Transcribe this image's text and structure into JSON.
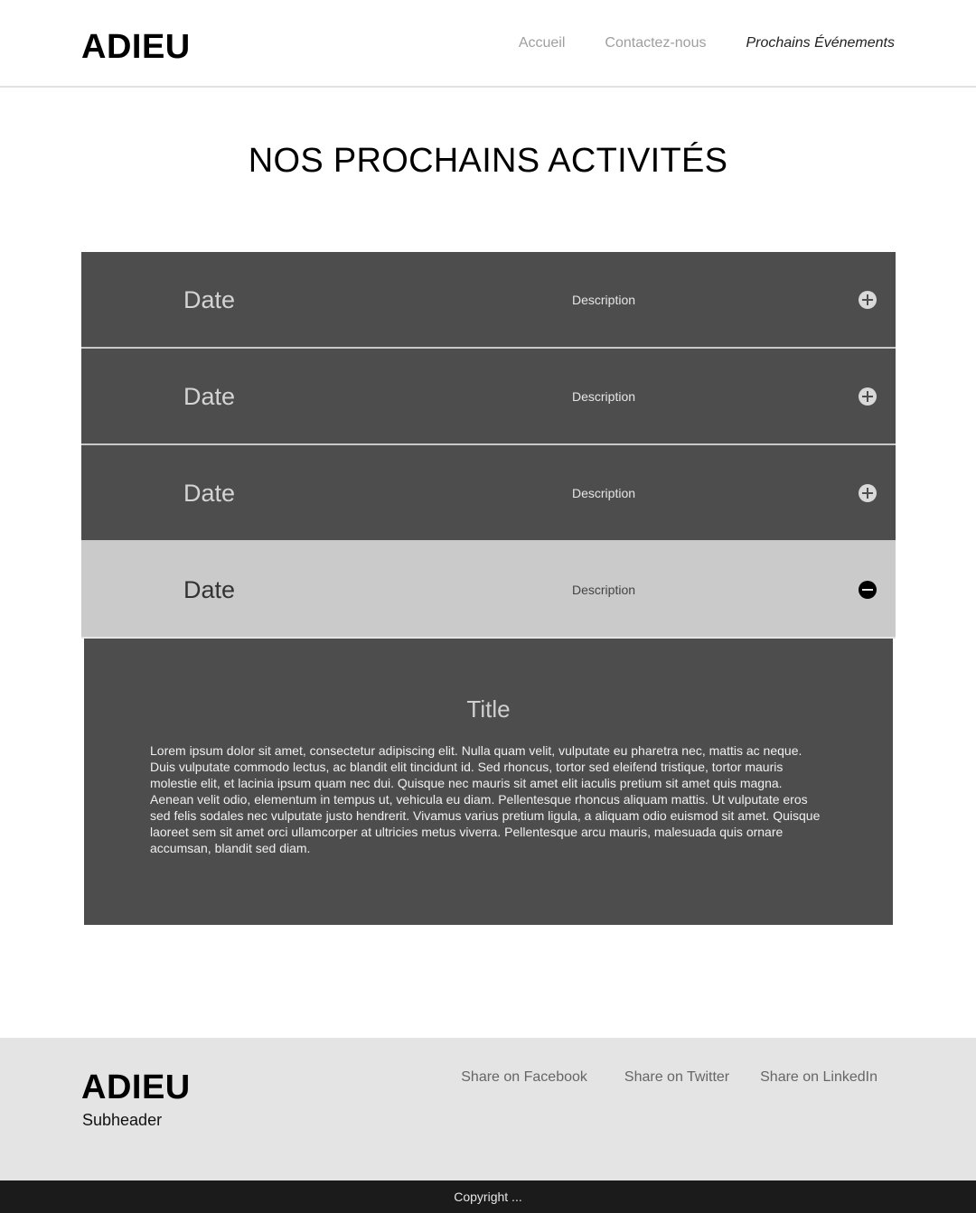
{
  "header": {
    "logo": "ADIEU",
    "nav": [
      {
        "label": "Accueil",
        "active": false
      },
      {
        "label": "Contactez-nous",
        "active": false
      },
      {
        "label": "Prochains Événements",
        "active": true
      }
    ]
  },
  "page_title": "NOS PROCHAINS ACTIVITÉS",
  "accordion": {
    "rows": [
      {
        "date": "Date",
        "description": "Description",
        "toggle_icon": "plus-circle-icon",
        "expanded": false
      },
      {
        "date": "Date",
        "description": "Description",
        "toggle_icon": "plus-circle-icon",
        "expanded": false
      },
      {
        "date": "Date",
        "description": "Description",
        "toggle_icon": "plus-circle-icon",
        "expanded": false
      },
      {
        "date": "Date",
        "description": "Description",
        "toggle_icon": "minus-circle-icon",
        "expanded": true
      }
    ],
    "panel": {
      "title": "Title",
      "body": "Lorem ipsum dolor sit amet, consectetur adipiscing elit. Nulla quam velit, vulputate eu pharetra nec, mattis ac neque. Duis vulputate commodo lectus, ac blandit elit tincidunt id. Sed rhoncus, tortor sed eleifend tristique, tortor mauris molestie elit, et lacinia ipsum quam nec dui. Quisque nec mauris sit amet elit iaculis pretium sit amet quis magna. Aenean velit odio, elementum in tempus ut, vehicula eu diam. Pellentesque rhoncus aliquam mattis. Ut vulputate eros sed felis sodales nec vulputate justo hendrerit. Vivamus varius pretium ligula, a aliquam odio euismod sit amet. Quisque laoreet sem sit amet orci ullamcorper at ultricies metus viverra. Pellentesque arcu mauris, malesuada quis ornare accumsan, blandit sed diam."
    }
  },
  "footer": {
    "logo": "ADIEU",
    "subheader": "Subheader",
    "share_links": [
      "Share on Facebook",
      "Share on Twitter",
      "Share on LinkedIn"
    ],
    "copyright": "Copyright ..."
  },
  "colors": {
    "accordion_row": "#4d4d4d",
    "accordion_row_open": "#cacaca",
    "footer_bg": "#e4e4e4",
    "copyright_bg": "#1b1b1b"
  }
}
